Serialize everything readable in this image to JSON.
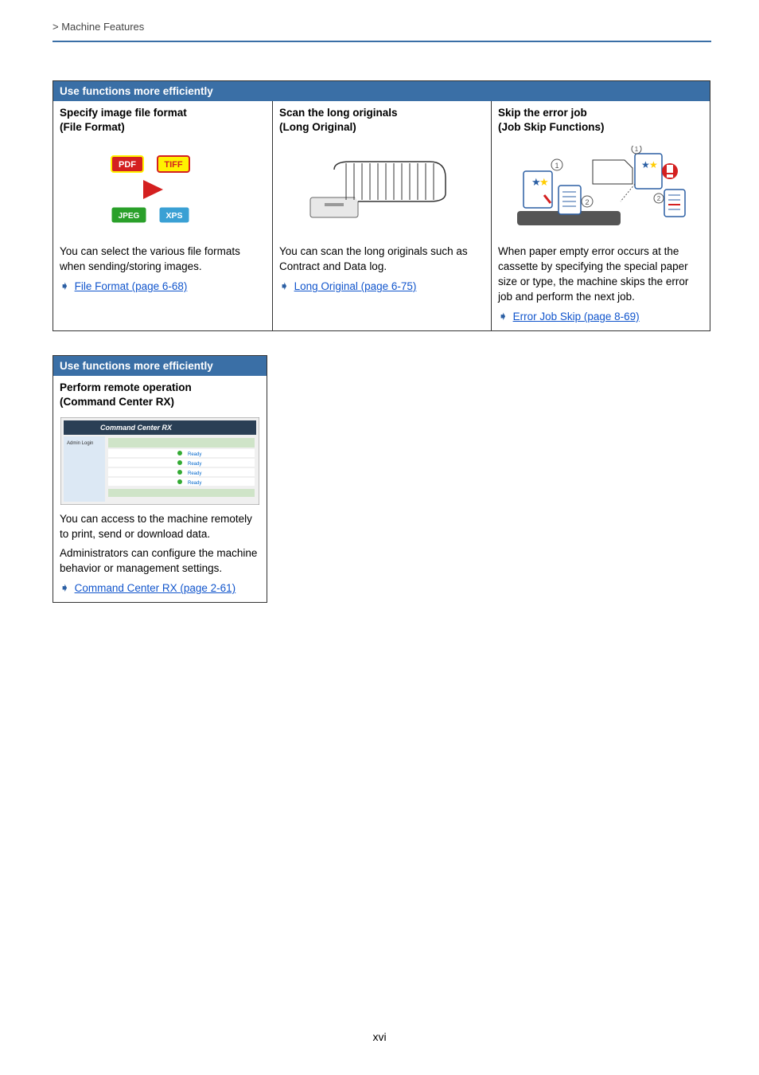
{
  "breadcrumb": "> Machine Features",
  "page_number": "xvi",
  "row1": {
    "header": "Use functions more efficiently",
    "cols": [
      {
        "title_l1": "Specify image file format",
        "title_l2": "(File Format)",
        "body": "You can select the various file formats when sending/storing images.",
        "link": "File Format (page 6-68)"
      },
      {
        "title_l1": "Scan the long originals",
        "title_l2": "(Long Original)",
        "body": "You can scan the long originals such as Contract and Data log.",
        "link": "Long Original (page 6-75)"
      },
      {
        "title_l1": "Skip the error job",
        "title_l2": "(Job Skip Functions)",
        "body": "When paper empty error occurs at the cassette by specifying the special paper size or type, the machine skips the error job and perform the next job.",
        "link": "Error Job Skip (page 8-69)"
      }
    ]
  },
  "row2": {
    "header": "Use functions more efficiently",
    "col": {
      "title_l1": "Perform remote operation",
      "title_l2": "(Command Center RX)",
      "body1": "You can access to the machine remotely to print, send or download data.",
      "body2": "Administrators can configure the machine behavior or management settings.",
      "link": "Command Center RX (page 2-61)"
    }
  },
  "icons": {
    "pdf": "PDF",
    "tiff": "TIFF",
    "jpeg": "JPEG",
    "xps": "XPS"
  }
}
